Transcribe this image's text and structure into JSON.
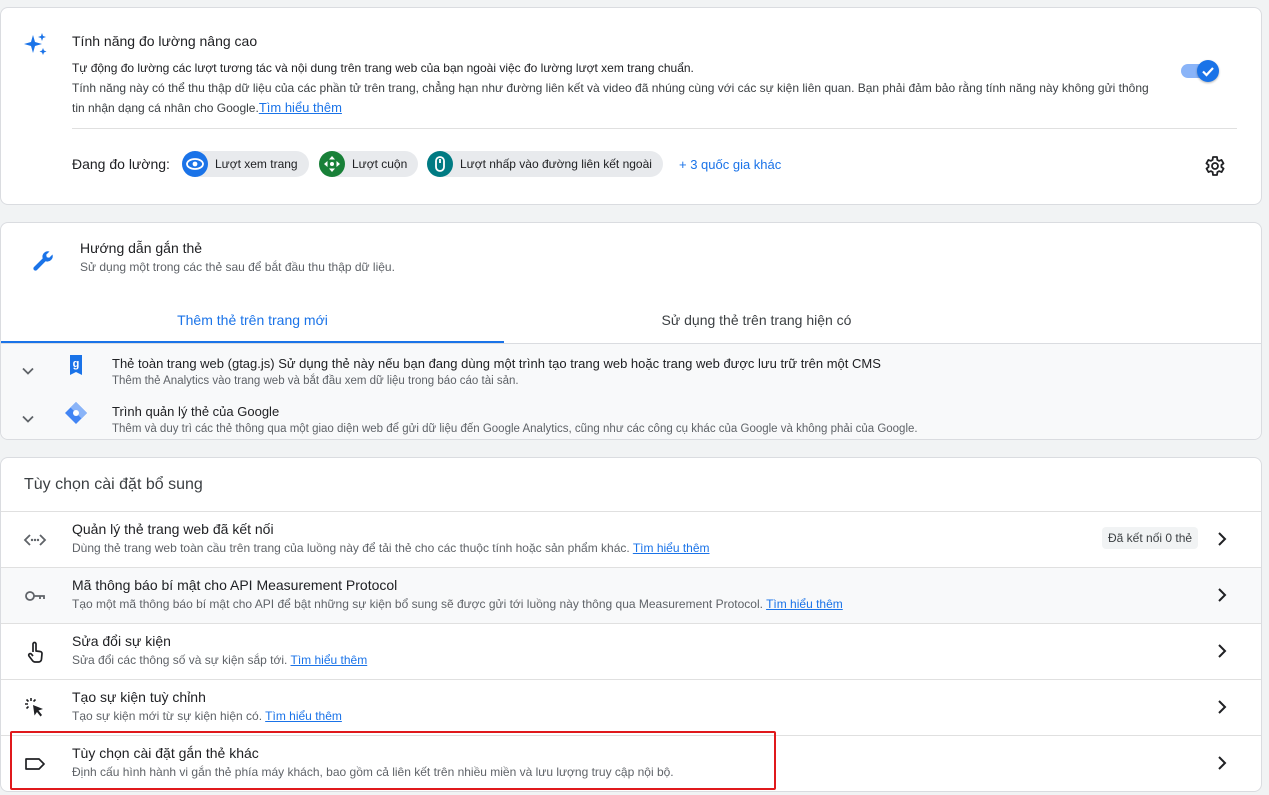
{
  "enhanced": {
    "title": "Tính năng đo lường nâng cao",
    "desc_line1": "Tự động đo lường các lượt tương tác và nội dung trên trang web của bạn ngoài việc đo lường lượt xem trang chuẩn.",
    "desc_line2": "Tính năng này có thể thu thập dữ liệu của các phần tử trên trang, chẳng hạn như đường liên kết và video đã nhúng cùng với các sự kiện liên quan. Bạn phải đảm bảo rằng tính năng này không gửi thông tin nhận dạng cá nhân cho Google.",
    "learn_more": "Tìm hiểu thêm",
    "toggle_on": true,
    "measuring_label": "Đang đo lường:",
    "chips": [
      "Lượt xem trang",
      "Lượt cuộn",
      "Lượt nhấp vào đường liên kết ngoài"
    ],
    "more": "+ 3 quốc gia khác"
  },
  "tagging": {
    "title": "Hướng dẫn gắn thẻ",
    "subtitle": "Sử dụng một trong các thẻ sau để bắt đầu thu thập dữ liệu.",
    "tabs": [
      "Thêm thẻ trên trang mới",
      "Sử dụng thẻ trên trang hiện có"
    ],
    "options": [
      {
        "title": "Thẻ toàn trang web (gtag.js) Sử dụng thẻ này nếu bạn đang dùng một trình tạo trang web hoặc trang web được lưu trữ trên một CMS",
        "desc": "Thêm thẻ Analytics vào trang web và bắt đầu xem dữ liệu trong báo cáo tài sản."
      },
      {
        "title": "Trình quản lý thẻ của Google",
        "desc": "Thêm và duy trì các thẻ thông qua một giao diện web để gửi dữ liệu đến Google Analytics, cũng như các công cụ khác của Google và không phải của Google."
      }
    ]
  },
  "additional": {
    "heading": "Tùy chọn cài đặt bổ sung",
    "rows": [
      {
        "title": "Quản lý thẻ trang web đã kết nối",
        "desc": "Dùng thẻ trang web toàn cầu trên trang của luồng này để tải thẻ cho các thuộc tính hoặc sản phẩm khác.",
        "link": "Tìm hiểu thêm",
        "badge": "Đã kết nối 0 thẻ"
      },
      {
        "title": "Mã thông báo bí mật cho API Measurement Protocol",
        "desc": "Tạo một mã thông báo bí mật cho API để bật những sự kiện bổ sung sẽ được gửi tới luồng này thông qua Measurement Protocol.",
        "link": "Tìm hiểu thêm"
      },
      {
        "title": "Sửa đổi sự kiện",
        "desc": "Sửa đổi các thông số và sự kiện sắp tới.",
        "link": "Tìm hiểu thêm"
      },
      {
        "title": "Tạo sự kiện tuỳ chỉnh",
        "desc": "Tạo sự kiện mới từ sự kiện hiện có.",
        "link": "Tìm hiểu thêm"
      },
      {
        "title": "Tùy chọn cài đặt gắn thẻ khác",
        "desc": "Định cấu hình hành vi gắn thẻ phía máy khách, bao gồm cả liên kết trên nhiều miền và lưu lượng truy cập nội bộ."
      }
    ]
  },
  "icons": {
    "sparkle": "sparkle-icon",
    "gear": "gear-icon",
    "wrench": "wrench-icon",
    "eye": "eye-icon",
    "scroll": "scroll-icon",
    "mouse": "mouse-icon",
    "chevron": "chevron-down-icon",
    "gtag": "gtag-icon",
    "gtm": "gtm-icon",
    "code": "code-arrows-icon",
    "key": "key-icon",
    "touch": "touch-icon",
    "click": "click-icon",
    "label": "label-icon",
    "arrow": "chevron-right-icon"
  },
  "colors": {
    "accent": "#1a73e8",
    "chip_blue": "#1a73e8",
    "chip_green": "#188038",
    "chip_teal": "#007b83",
    "highlight": "#e0191c"
  }
}
